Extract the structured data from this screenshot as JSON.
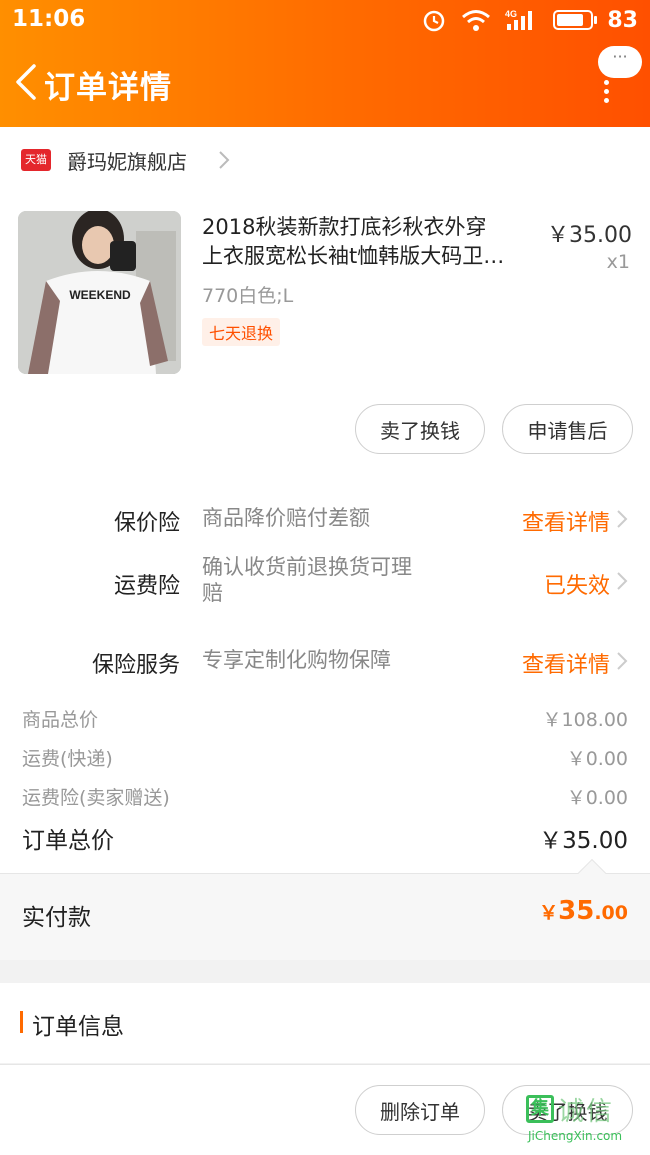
{
  "status_bar": {
    "time": "11:06",
    "battery_text": "83",
    "battery_level": 0.83
  },
  "nav": {
    "title": "订单详情",
    "more_label": "···"
  },
  "shop": {
    "badge": "天猫",
    "name": "爵玛妮旗舰店"
  },
  "product": {
    "title_line1": "2018秋装新款打底衫秋衣外穿",
    "title_line2": "上衣服宽松长袖t恤韩版大码卫…",
    "sku": "770白色;L",
    "tag": "七天退换",
    "price": "￥35.00",
    "qty": "x1",
    "image_text": "WEEKEND"
  },
  "actions": {
    "sell_label": "卖了换钱",
    "after_sale_label": "申请售后"
  },
  "insurance": [
    {
      "label": "保价险",
      "desc": "商品降价赔付差额",
      "action": "查看详情"
    },
    {
      "label": "运费险",
      "desc": "确认收货前退换货可理赔",
      "action": "已失效"
    },
    {
      "label": "保险服务",
      "desc": "专享定制化购物保障",
      "action": "查看详情"
    }
  ],
  "summary": {
    "goods_total_label": "商品总价",
    "goods_total_value": "￥108.00",
    "shipping_label": "运费(快递)",
    "shipping_value": "￥0.00",
    "ship_ins_label": "运费险(卖家赠送)",
    "ship_ins_value": "￥0.00",
    "order_total_label": "订单总价",
    "order_total_value": "￥35.00"
  },
  "paid": {
    "label": "实付款",
    "currency": "￥",
    "integer": "35",
    "decimal": ".00"
  },
  "order_info": {
    "title": "订单信息"
  },
  "bottom": {
    "delete_label": "删除订单",
    "sell_label": "卖了换钱"
  },
  "watermark": {
    "logo_char": "集",
    "cn": "诚信",
    "en": "JiChengXin.com"
  },
  "colors": {
    "accent": "#ff6a00",
    "header_start": "#ff8f00",
    "header_end": "#ff5000",
    "tmall_red": "#e4272c"
  }
}
